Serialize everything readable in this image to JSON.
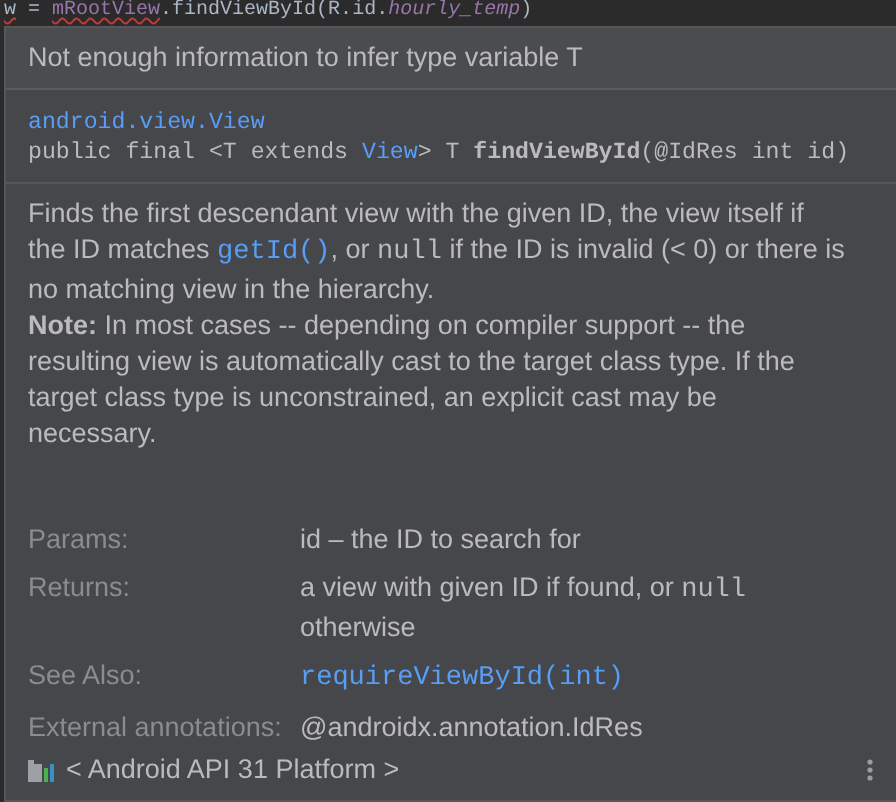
{
  "editor": {
    "code_tokens": [
      {
        "kind": "local",
        "text": "w"
      },
      {
        "kind": "plain",
        "text": " = "
      },
      {
        "kind": "field",
        "text": "mRootView"
      },
      {
        "kind": "plain",
        "text": ".findViewById(R.id."
      },
      {
        "kind": "static",
        "text": "hourly_temp"
      },
      {
        "kind": "plain",
        "text": ")"
      }
    ]
  },
  "popup": {
    "error": "Not enough information to infer type variable T",
    "signature": {
      "class_name": "android.view.View",
      "tokens": [
        {
          "kind": "plain",
          "text": "public final <T extends "
        },
        {
          "kind": "link",
          "text": "View"
        },
        {
          "kind": "plain",
          "text": "> T "
        },
        {
          "kind": "bold",
          "text": "findViewById"
        },
        {
          "kind": "plain",
          "text": "(@IdRes int id)"
        }
      ]
    },
    "description": [
      {
        "kind": "text",
        "text": "Finds the first descendant view with the given ID, the view itself if the ID matches "
      },
      {
        "kind": "link",
        "text": "getId()"
      },
      {
        "kind": "text",
        "text": ", or "
      },
      {
        "kind": "code",
        "text": "null"
      },
      {
        "kind": "text",
        "text": " if the ID is invalid (< 0) or there is no matching view in the hierarchy."
      },
      {
        "kind": "break"
      },
      {
        "kind": "bold",
        "text": "Note:"
      },
      {
        "kind": "text",
        "text": " In most cases -- depending on compiler support -- the resulting view is automatically cast to the target class type. If the target class type is unconstrained, an explicit cast may be necessary."
      }
    ],
    "sections": [
      {
        "label": "Params:",
        "value": [
          {
            "kind": "text",
            "text": "id – the ID to search for"
          }
        ]
      },
      {
        "label": "Returns:",
        "value": [
          {
            "kind": "text",
            "text": "a view with given ID if found, or "
          },
          {
            "kind": "code",
            "text": "null"
          },
          {
            "kind": "text",
            "text": " otherwise"
          }
        ]
      },
      {
        "label": "See Also:",
        "value": [
          {
            "kind": "link",
            "text": "requireViewById(int)"
          }
        ]
      },
      {
        "label": "External annotations:",
        "value": [
          {
            "kind": "text",
            "text": "@androidx.annotation.IdRes"
          }
        ]
      }
    ],
    "footer": "< Android API 31 Platform >"
  }
}
